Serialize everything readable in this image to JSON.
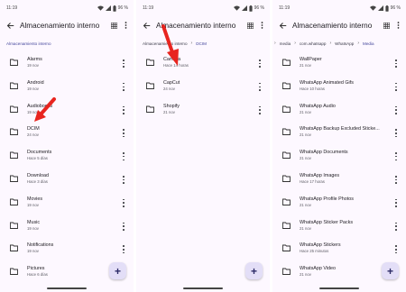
{
  "status": {
    "time": "11:19",
    "battery": "96 %"
  },
  "appbar": {
    "title": "Almacenamiento interno"
  },
  "screens": [
    {
      "breadcrumb": [
        "Almacenamiento interno"
      ],
      "items": [
        {
          "name": "Alarms",
          "sub": "19 nov"
        },
        {
          "name": "Android",
          "sub": "19 nov"
        },
        {
          "name": "Audiobooks",
          "sub": "19 nov"
        },
        {
          "name": "DCIM",
          "sub": "24 nov"
        },
        {
          "name": "Documents",
          "sub": "Hace 5 días"
        },
        {
          "name": "Download",
          "sub": "Hace 3 días"
        },
        {
          "name": "Movies",
          "sub": "19 nov"
        },
        {
          "name": "Music",
          "sub": "19 nov"
        },
        {
          "name": "Notifications",
          "sub": "19 nov"
        },
        {
          "name": "Pictures",
          "sub": "Hace 6 días"
        }
      ]
    },
    {
      "breadcrumb": [
        "Almacenamiento interno",
        "DCIM"
      ],
      "items": [
        {
          "name": "Camera",
          "sub": "Hace 14 horas"
        },
        {
          "name": "CapCut",
          "sub": "24 nov"
        },
        {
          "name": "Shopify",
          "sub": "21 nov"
        }
      ]
    },
    {
      "breadcrumb": [
        "media",
        "com.whatsapp",
        "WhatsApp",
        "Media"
      ],
      "items": [
        {
          "name": "WallPaper",
          "sub": "21 nov"
        },
        {
          "name": "WhatsApp Animated Gifs",
          "sub": "Hace 10 horas"
        },
        {
          "name": "WhatsApp Audio",
          "sub": "21 nov"
        },
        {
          "name": "WhatsApp Backup Excluded Sticke...",
          "sub": "21 nov"
        },
        {
          "name": "WhatsApp Documents",
          "sub": "21 nov"
        },
        {
          "name": "WhatsApp Images",
          "sub": "Hace 17 horas"
        },
        {
          "name": "WhatsApp Profile Photos",
          "sub": "21 nov"
        },
        {
          "name": "WhatsApp Sticker Packs",
          "sub": "21 nov"
        },
        {
          "name": "WhatsApp Stickers",
          "sub": "Hace 25 minutos"
        },
        {
          "name": "WhatsApp Video",
          "sub": "21 nov"
        }
      ]
    }
  ],
  "fab": {
    "label": "+"
  },
  "colors": {
    "accent": "#44469b",
    "background": "#fdf8ff",
    "fab": "#e3def7",
    "arrow": "#e8251f"
  },
  "icons": {
    "back": "arrow-left-icon",
    "grid": "grid-view-icon",
    "more": "more-vert-icon",
    "folder": "folder-icon",
    "wifi": "wifi-icon",
    "signal": "signal-icon",
    "battery": "battery-icon",
    "add": "add-icon"
  }
}
